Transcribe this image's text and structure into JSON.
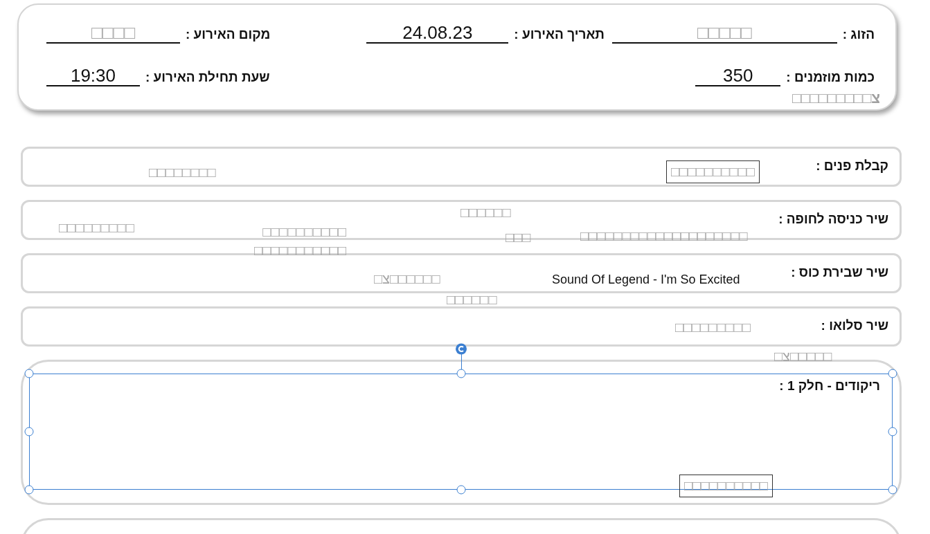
{
  "header": {
    "fields": [
      {
        "label": "הזוג :",
        "value": "□□□□□"
      },
      {
        "label": "תאריך האירוע :",
        "value": "24.08.23"
      },
      {
        "label": "מקום האירוע :",
        "value": "□□□□"
      },
      {
        "label": "כמות מוזמנים :",
        "value": "350"
      },
      {
        "label": "שעת תחילת האירוע :",
        "value": "19:30"
      }
    ],
    "note": "צ□□□□□□□□□"
  },
  "sections": [
    {
      "label": "קבלת פנים :",
      "selected": false
    },
    {
      "label": "שיר כניסה לחופה :",
      "selected": false
    },
    {
      "label": "שיר שבירת כוס :",
      "selected": false
    },
    {
      "label": "שיר סלואו :",
      "selected": false
    },
    {
      "label": "ריקודים - חלק 1 :",
      "selected": true
    }
  ],
  "text_boxes": [
    {
      "text": "□□□□□□□□",
      "kind": "plain"
    },
    {
      "text": "□□□□□□□□□□",
      "kind": "framed"
    },
    {
      "text": "□□□□□□□□□",
      "kind": "plain"
    },
    {
      "text": "□□□□□□□□□□ □□□□□□□□□□□",
      "kind": "plain"
    },
    {
      "text": "□□□□□□",
      "kind": "plain"
    },
    {
      "text": "□□□□□□□□□□□□□□□□□□□□",
      "kind": "plain"
    },
    {
      "text": "□□□",
      "kind": "plain"
    },
    {
      "text": "Sound Of Legend - I'm So Excited",
      "kind": "song"
    },
    {
      "text": "□□□□□□צ□",
      "kind": "plain"
    },
    {
      "text": "□□□□□□",
      "kind": "plain"
    },
    {
      "text": "□□□□□□□□□",
      "kind": "plain"
    },
    {
      "text": "□□□□□צ□",
      "kind": "plain"
    },
    {
      "text": "□□□□□□□□□□",
      "kind": "framed"
    }
  ]
}
